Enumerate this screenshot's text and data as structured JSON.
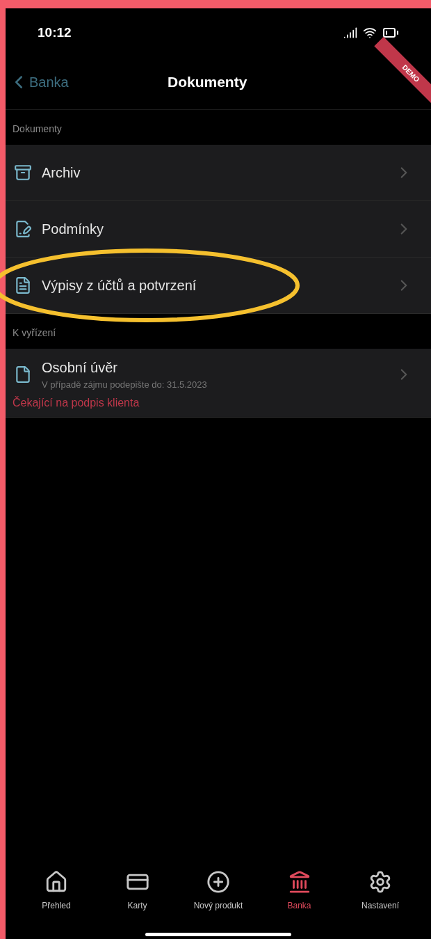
{
  "status_bar": {
    "time": "10:12"
  },
  "nav": {
    "back": "Banka",
    "title": "Dokumenty",
    "ribbon": "DEMO"
  },
  "sections": [
    {
      "header": "Dokumenty",
      "items": [
        {
          "kind": "archive",
          "label": "Archiv",
          "highlighted": false
        },
        {
          "kind": "terms",
          "label": "Podmínky",
          "highlighted": false
        },
        {
          "kind": "statement",
          "label": "Výpisy z účtů a potvrzení",
          "highlighted": true
        }
      ]
    },
    {
      "header": "K vyřízení",
      "items": [
        {
          "kind": "task",
          "label": "Osobní úvěr",
          "subtitle": "V případě zájmu podepište do: 31.5.2023",
          "status": "Čekající na podpis klienta",
          "highlighted": false
        }
      ]
    }
  ],
  "tabs": [
    {
      "kind": "home",
      "label": "Přehled",
      "selected": false
    },
    {
      "kind": "cards",
      "label": "Karty",
      "selected": false
    },
    {
      "kind": "new",
      "label": "Nový produkt",
      "selected": false
    },
    {
      "kind": "bank",
      "label": "Banka",
      "selected": true
    },
    {
      "kind": "settings",
      "label": "Nastavení",
      "selected": false
    }
  ]
}
